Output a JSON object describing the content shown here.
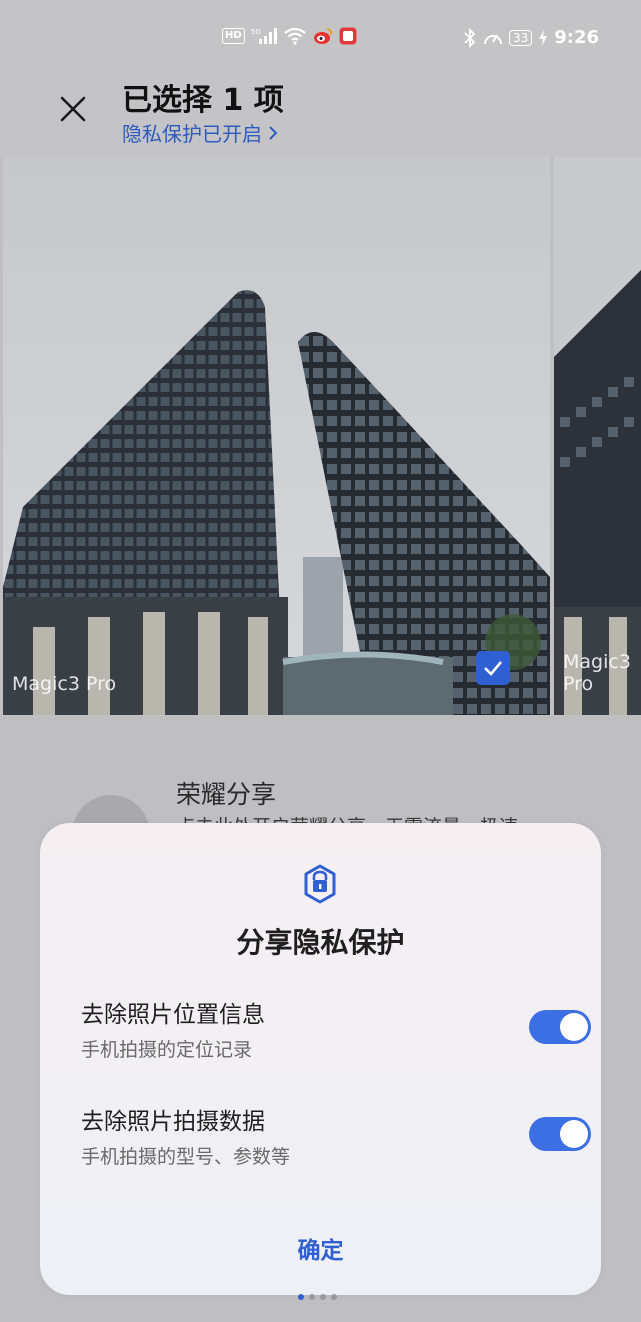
{
  "status_bar": {
    "left_icons": [
      "hd-icon",
      "5g-signal-icon",
      "wifi-icon",
      "weibo-icon",
      "app-icon"
    ],
    "hd_label": "HD",
    "battery": "33",
    "time": "9:26"
  },
  "header": {
    "title": "已选择 1 项",
    "subtitle": "隐私保护已开启",
    "close_icon": "close-icon",
    "chevron_icon": "chevron-right-icon"
  },
  "gallery": {
    "main_caption": "Magic3 Pro",
    "side_caption": "Magic3 Pro",
    "selected": true
  },
  "share": {
    "title": "荣耀分享",
    "desc": "点击此处开启荣耀分享，无需流量，极速"
  },
  "dialog": {
    "title": "分享隐私保护",
    "options": [
      {
        "title": "去除照片位置信息",
        "desc": "手机拍摄的定位记录",
        "enabled": true
      },
      {
        "title": "去除照片拍摄数据",
        "desc": "手机拍摄的型号、参数等",
        "enabled": true
      }
    ],
    "confirm_label": "确定"
  },
  "pager": {
    "count": 4,
    "active": 0
  },
  "colors": {
    "accent": "#2f5fd0",
    "toggle_on": "#3b6fe3"
  }
}
